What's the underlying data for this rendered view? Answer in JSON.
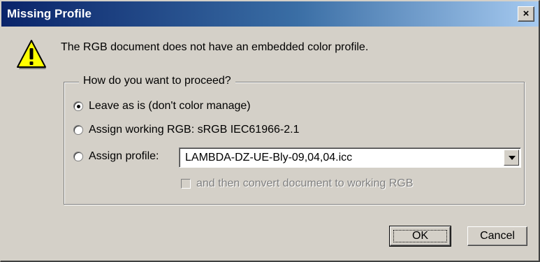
{
  "window": {
    "title": "Missing Profile",
    "close_label": "×"
  },
  "message": "The RGB document does not have an embedded color profile.",
  "icon": "warning-icon",
  "group": {
    "legend": "How do you want to proceed?",
    "options": [
      {
        "label": "Leave as is (don't color manage)",
        "selected": true
      },
      {
        "label": "Assign working RGB:  sRGB IEC61966-2.1",
        "selected": false
      },
      {
        "label": "Assign profile:",
        "selected": false
      }
    ],
    "profile_select": {
      "value": "LAMBDA-DZ-UE-Bly-09,04,04.icc"
    },
    "convert_checkbox": {
      "label": "and then convert document to working RGB",
      "checked": false,
      "disabled": true
    }
  },
  "buttons": {
    "ok": "OK",
    "cancel": "Cancel"
  },
  "colors": {
    "face": "#d4d0c8",
    "title_start": "#0a246a",
    "title_end": "#a6caf0",
    "warning_yellow": "#ffff00"
  }
}
